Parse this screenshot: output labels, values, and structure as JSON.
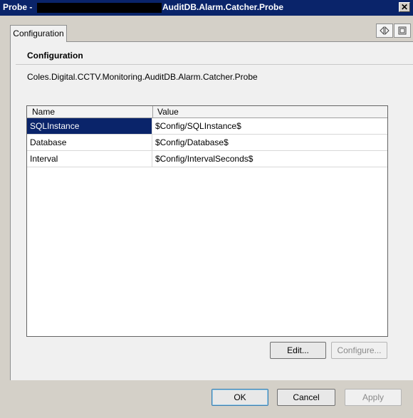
{
  "window": {
    "title_prefix": "Probe -",
    "title_suffix": "AuditDB.Alarm.Catcher.Probe",
    "close_glyph": "✕"
  },
  "tab": {
    "label": "Configuration"
  },
  "nav_icons": [
    "expand-collapse-icon",
    "properties-icon"
  ],
  "section": {
    "header": "Configuration",
    "description": "Coles.Digital.CCTV.Monitoring.AuditDB.Alarm.Catcher.Probe"
  },
  "grid": {
    "columns": [
      "Name",
      "Value"
    ],
    "rows": [
      {
        "name": "SQLInstance",
        "value": "$Config/SQLInstance$"
      },
      {
        "name": "Database",
        "value": "$Config/Database$"
      },
      {
        "name": "Interval",
        "value": "$Config/IntervalSeconds$"
      }
    ],
    "selected_row": "SQLInstance"
  },
  "buttons": {
    "edit": "Edit...",
    "configure": "Configure...",
    "ok": "OK",
    "cancel": "Cancel",
    "apply": "Apply"
  },
  "colors": {
    "titlebar": "#0a246a",
    "selection": "#0a246a",
    "dialog_bg": "#d4d0c8"
  }
}
